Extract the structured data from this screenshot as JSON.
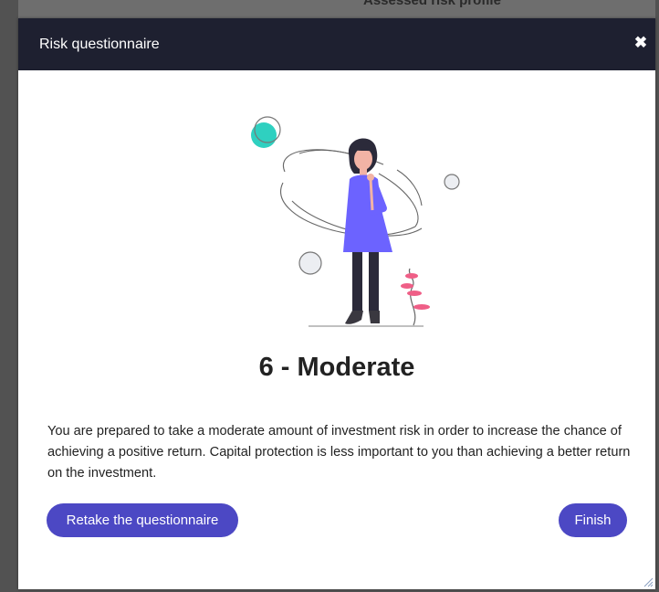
{
  "background": {
    "title": "Assessed risk profile"
  },
  "modal": {
    "title": "Risk questionnaire",
    "close_icon": "close-icon",
    "result_title": "6 - Moderate",
    "description": "You are prepared to take a moderate amount of investment risk in order to increase the chance of achieving a positive return. Capital protection is less important to you than achieving a better return on the investment.",
    "buttons": {
      "retake_label": "Retake the questionnaire",
      "finish_label": "Finish"
    }
  },
  "colors": {
    "header_bg": "#1e2030",
    "accent": "#4c48c4",
    "teal": "#2fd0c0",
    "dress": "#6c63ff",
    "plant": "#ef5f87"
  }
}
